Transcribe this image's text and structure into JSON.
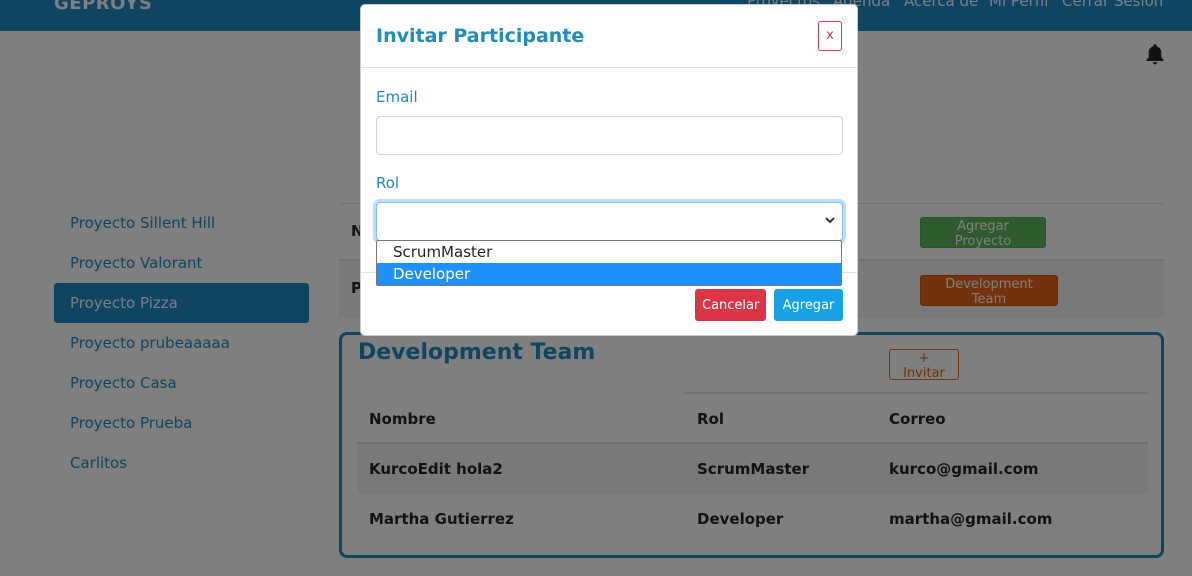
{
  "navbar": {
    "brand": "GEPROYS",
    "links": [
      "Proyectos",
      "Agenda",
      "Acerca de",
      "Mi Perfil",
      "Cerrar Sesión"
    ]
  },
  "sidebar": {
    "items": [
      {
        "label": "Proyecto Sillent Hill",
        "active": false
      },
      {
        "label": "Proyecto Valorant",
        "active": false
      },
      {
        "label": "Proyecto Pizza",
        "active": true
      },
      {
        "label": "Proyecto prubeaaaaa",
        "active": false
      },
      {
        "label": "Proyecto Casa",
        "active": false
      },
      {
        "label": "Proyecto Prueba",
        "active": false
      },
      {
        "label": "Carlitos",
        "active": false
      }
    ]
  },
  "project_table": {
    "row1_initial": "N",
    "row2_initial": "P",
    "add_project_label": "Agregar Proyecto",
    "dev_team_label": "Development Team"
  },
  "dev_team": {
    "title": "Development Team",
    "invite_label": "+ Invitar",
    "columns": [
      "Nombre",
      "Rol",
      "Correo"
    ],
    "rows": [
      {
        "nombre": "KurcoEdit hola2",
        "rol": "ScrumMaster",
        "correo": "kurco@gmail.com"
      },
      {
        "nombre": "Martha Gutierrez",
        "rol": "Developer",
        "correo": "martha@gmail.com"
      }
    ]
  },
  "modal": {
    "title": "Invitar Participante",
    "close_label": "x",
    "email_label": "Email",
    "email_value": "",
    "rol_label": "Rol",
    "rol_value": "",
    "rol_options": [
      "ScrumMaster",
      "Developer"
    ],
    "rol_highlighted": "Developer",
    "cancel_label": "Cancelar",
    "add_label": "Agregar"
  },
  "colors": {
    "primary": "#1e8bc3",
    "danger": "#dc3545",
    "success": "#5cb85c",
    "warning": "#e8621a",
    "info": "#17a2e8"
  }
}
